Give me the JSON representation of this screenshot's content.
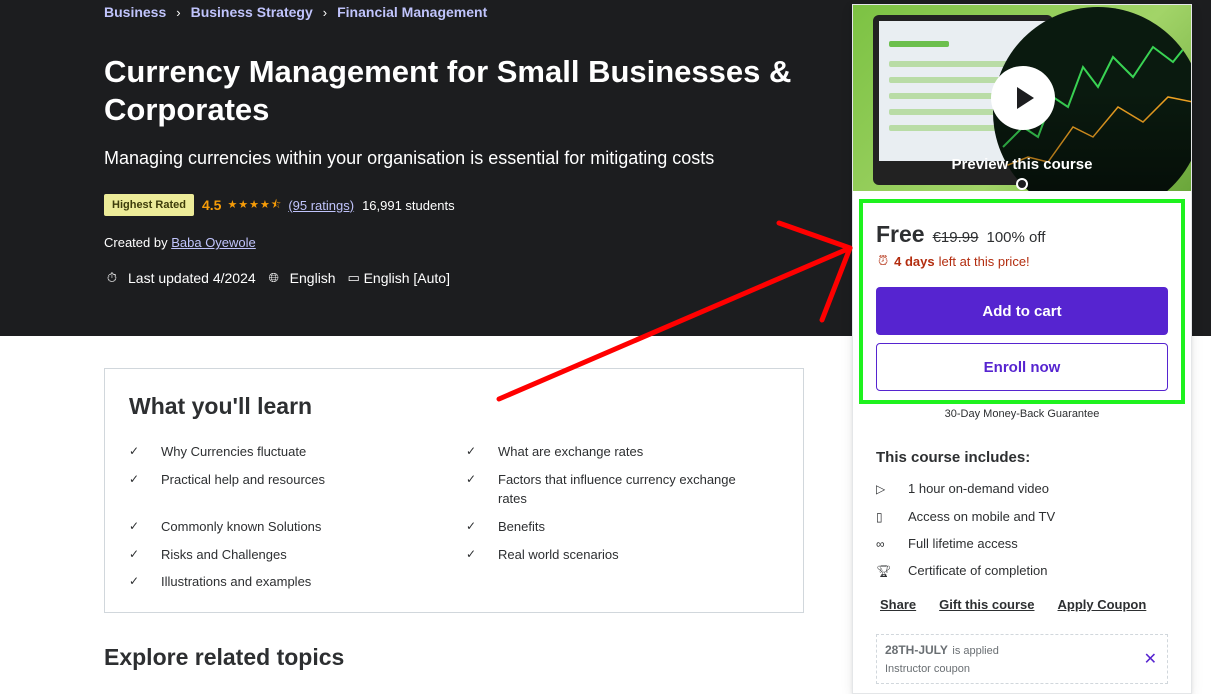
{
  "breadcrumb": [
    "Business",
    "Business Strategy",
    "Financial Management"
  ],
  "course": {
    "title": "Currency Management for Small Businesses & Corporates",
    "subtitle": "Managing currencies within your organisation is essential for mitigating costs",
    "badge": "Highest Rated",
    "rating": "4.5",
    "rating_value": 4.5,
    "ratings_link": "(95 ratings)",
    "students": "16,991 students",
    "created_by_label": "Created by",
    "instructor": "Baba Oyewole",
    "last_updated": "Last updated 4/2024",
    "language": "English",
    "captions": "English [Auto]"
  },
  "learn": {
    "heading": "What you'll learn",
    "left": [
      "Why Currencies fluctuate",
      "Practical help and resources",
      "Commonly known Solutions",
      "Risks and Challenges",
      "Illustrations and examples"
    ],
    "right": [
      "What are exchange rates",
      "Factors that influence currency exchange rates",
      "Benefits",
      "Real world scenarios"
    ]
  },
  "explore_heading": "Explore related topics",
  "sidebar": {
    "preview_label": "Preview this course",
    "price": "Free",
    "original_price": "€19.99",
    "discount": "100% off",
    "timer_days": "4 days",
    "timer_rest": "left at this price!",
    "add_to_cart": "Add to cart",
    "enroll_now": "Enroll now",
    "guarantee": "30-Day Money-Back Guarantee",
    "includes_heading": "This course includes:",
    "includes": [
      {
        "icon": "video-icon",
        "text": "1 hour on-demand video"
      },
      {
        "icon": "mobile-icon",
        "text": "Access on mobile and TV"
      },
      {
        "icon": "infinity-icon",
        "text": "Full lifetime access"
      },
      {
        "icon": "trophy-icon",
        "text": "Certificate of completion"
      }
    ],
    "links": [
      "Share",
      "Gift this course",
      "Apply Coupon"
    ],
    "coupon": {
      "code": "28TH-JULY",
      "applied": "is applied",
      "sub": "Instructor coupon"
    }
  },
  "colors": {
    "hero_bg": "#1c1d1f",
    "accent": "#5624d0",
    "link": "#c0c4fc",
    "highlight_box": "#1ef21e",
    "annotation_arrow": "#ff0000",
    "rating": "#f69c08"
  }
}
